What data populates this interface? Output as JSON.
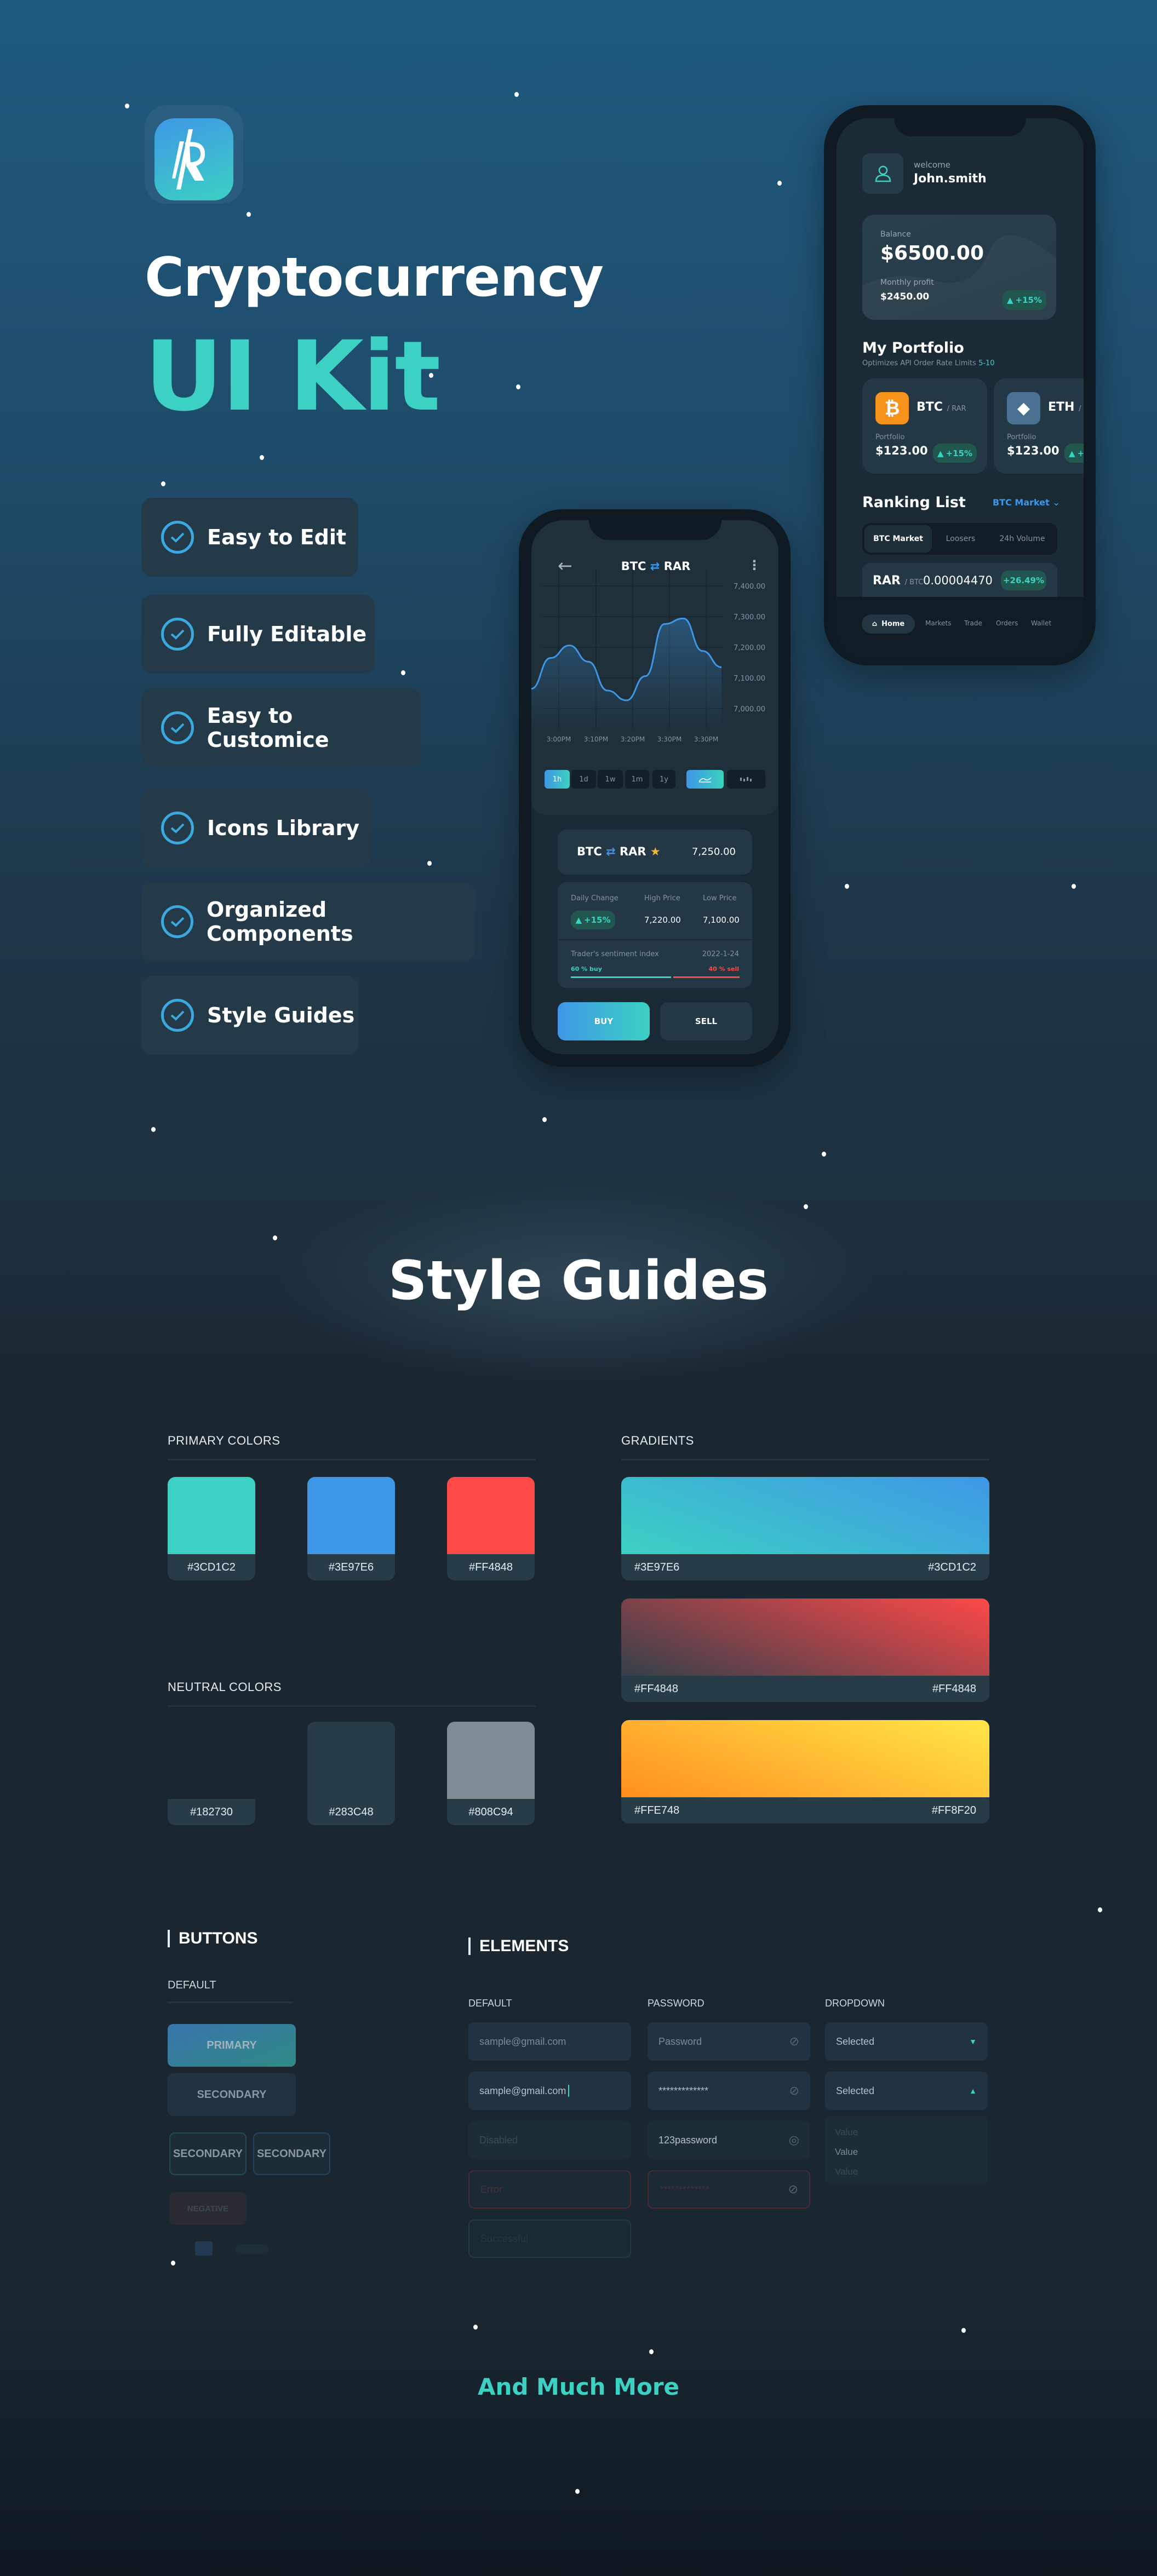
{
  "hero": {
    "title": "Cryptocurrency",
    "subtitle": "UI Kit",
    "features": [
      "Easy to Edit",
      "Fully Editable",
      "Easy to Customice",
      "Icons Library",
      "Organized Components",
      "Style Guides"
    ]
  },
  "home_screen": {
    "welcome": "welcome",
    "username": "John.smith",
    "balance_label": "Balance",
    "balance": "$6500.00",
    "profit_label": "Monthly profit",
    "profit": "$2450.00",
    "profit_change": "+15%",
    "portfolio_title": "My Portfolio",
    "portfolio_subtitle": "Optimizes API Order Rate Limits",
    "portfolio_subtitle_accent": "5-10",
    "coins": [
      {
        "symbol": "BTC",
        "pair": "/ RAR",
        "label": "Portfolio",
        "value": "$123.00",
        "change": "+15%"
      },
      {
        "symbol": "ETH",
        "pair": "/",
        "label": "Portfolio",
        "value": "$123.00",
        "change": "+15%"
      }
    ],
    "ranking_title": "Ranking List",
    "market_select": "BTC Market",
    "tabs": [
      "BTC Market",
      "Loosers",
      "24h Volume"
    ],
    "row": {
      "symbol": "RAR",
      "pair": "/ BTC",
      "price": "0.00004470",
      "change": "+26.49%"
    },
    "nav": [
      "Home",
      "Markets",
      "Trade",
      "Orders",
      "Wallet"
    ]
  },
  "trade_screen": {
    "base": "BTC",
    "quote": "RAR",
    "chart": {
      "type": "line",
      "y_ticks": [
        "7,400.00",
        "7,300.00",
        "7,200.00",
        "7,100.00",
        "7,000.00"
      ],
      "ylim": [
        7000,
        7400
      ],
      "x_labels": [
        "3:00PM",
        "3:10PM",
        "3:20PM",
        "3:30PM",
        "3:30PM"
      ],
      "values": [
        7065,
        7165,
        7206,
        7153,
        7059,
        7027,
        7106,
        7276,
        7294,
        7188,
        7135
      ],
      "color": "#3e97e6"
    },
    "periods": [
      "1h",
      "1d",
      "1w",
      "1m",
      "1y"
    ],
    "active_period": "1h",
    "price": "7,250.00",
    "stats": [
      {
        "label": "Daily Change",
        "value": "+15%"
      },
      {
        "label": "High Price",
        "value": "7,220.00"
      },
      {
        "label": "Low Price",
        "value": "7,100.00"
      }
    ],
    "sentiment_label": "Trader's sentiment index",
    "sentiment_date": "2022-1-24",
    "buy_text": "60 % buy",
    "sell_text": "40 % sell",
    "buy_pct": 60,
    "buy": "BUY",
    "sell": "SELL"
  },
  "style_guides": {
    "title": "Style Guides",
    "primary_label": "PRIMARY COLORS",
    "primary": [
      "#3CD1C2",
      "#3E97E6",
      "#FF4848"
    ],
    "neutral_label": "NEUTRAL COLORS",
    "neutral": [
      "#182730",
      "#283C48",
      "#808C94"
    ],
    "gradients_label": "GRADIENTS",
    "gradients": [
      {
        "from": "#3E97E6",
        "to": "#3CD1C2"
      },
      {
        "from": "#FF4848",
        "to": "#FF4848"
      },
      {
        "from": "#FFE748",
        "to": "#FF8F20"
      }
    ]
  },
  "buttons": {
    "title": "BUTTONS",
    "default": "DEFAULT",
    "primary": "PRIMARY",
    "secondary": "SECONDARY",
    "outline1": "SECONDARY",
    "outline2": "SECONDARY",
    "negative": "NEGATIVE"
  },
  "elements": {
    "title": "ELEMENTS",
    "col_default": "DEFAULT",
    "col_password": "PASSWORD",
    "col_dropdown": "DROPDOWN",
    "default_inputs": [
      "sample@gmail.com",
      "sample@gmail.com",
      "Disabled",
      "Error",
      "Successful"
    ],
    "password_inputs": [
      "Password",
      "*************",
      "123password",
      "*************"
    ],
    "dropdowns": [
      "Selected",
      "Selected"
    ],
    "dropdown_options": [
      "Value",
      "Value",
      "Value"
    ]
  },
  "footer": {
    "more": "And Much More"
  }
}
